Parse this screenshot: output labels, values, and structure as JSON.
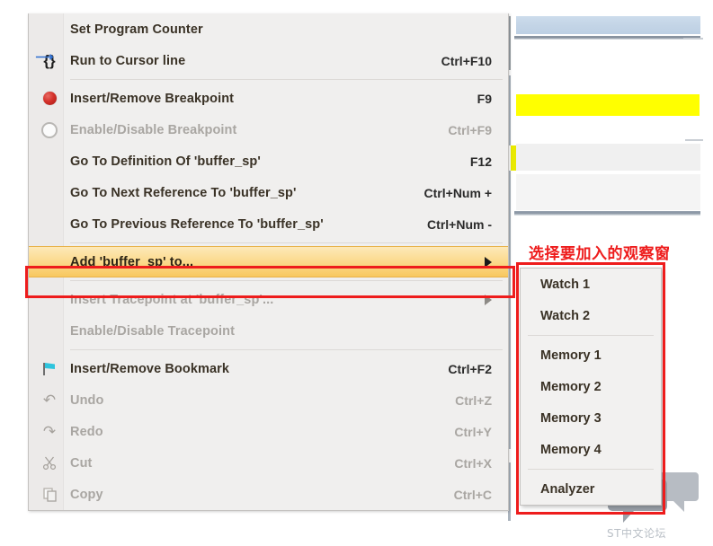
{
  "context_menu": {
    "items": [
      {
        "label": "Set Program Counter",
        "shortcut": "",
        "icon": "",
        "disabled": false,
        "submenu": false
      },
      {
        "label": "Run to Cursor line",
        "shortcut": "Ctrl+F10",
        "icon": "run-to-cursor-icon",
        "disabled": false,
        "submenu": false
      },
      {
        "separator": true
      },
      {
        "label": "Insert/Remove Breakpoint",
        "shortcut": "F9",
        "icon": "breakpoint-icon",
        "disabled": false,
        "submenu": false
      },
      {
        "label": "Enable/Disable Breakpoint",
        "shortcut": "Ctrl+F9",
        "icon": "breakpoint-disabled-icon",
        "disabled": true,
        "submenu": false
      },
      {
        "label": "Go To Definition Of 'buffer_sp'",
        "shortcut": "F12",
        "icon": "",
        "disabled": false,
        "submenu": false
      },
      {
        "label": "Go To Next Reference To 'buffer_sp'",
        "shortcut": "Ctrl+Num +",
        "icon": "",
        "disabled": false,
        "submenu": false
      },
      {
        "label": "Go To Previous Reference To 'buffer_sp'",
        "shortcut": "Ctrl+Num -",
        "icon": "",
        "disabled": false,
        "submenu": false
      },
      {
        "separator": true
      },
      {
        "label": "Add 'buffer_sp' to...",
        "shortcut": "",
        "icon": "",
        "disabled": false,
        "submenu": true,
        "highlighted": true
      },
      {
        "separator": true
      },
      {
        "label": "Insert Tracepoint at 'buffer_sp'...",
        "shortcut": "",
        "icon": "",
        "disabled": true,
        "submenu": true
      },
      {
        "label": "Enable/Disable Tracepoint",
        "shortcut": "",
        "icon": "",
        "disabled": true,
        "submenu": false
      },
      {
        "separator": true
      },
      {
        "label": "Insert/Remove Bookmark",
        "shortcut": "Ctrl+F2",
        "icon": "bookmark-flag-icon",
        "disabled": false,
        "submenu": false
      },
      {
        "label": "Undo",
        "shortcut": "Ctrl+Z",
        "icon": "undo-icon",
        "disabled": true,
        "submenu": false
      },
      {
        "label": "Redo",
        "shortcut": "Ctrl+Y",
        "icon": "redo-icon",
        "disabled": true,
        "submenu": false
      },
      {
        "label": "Cut",
        "shortcut": "Ctrl+X",
        "icon": "cut-scissors-icon",
        "disabled": true,
        "submenu": false
      },
      {
        "label": "Copy",
        "shortcut": "Ctrl+C",
        "icon": "copy-icon",
        "disabled": true,
        "submenu": false
      }
    ]
  },
  "submenu": {
    "items": [
      {
        "label": "Watch 1"
      },
      {
        "label": "Watch 2"
      },
      {
        "separator": true
      },
      {
        "label": "Memory 1"
      },
      {
        "label": "Memory 2"
      },
      {
        "label": "Memory 3"
      },
      {
        "label": "Memory 4"
      },
      {
        "separator": true
      },
      {
        "label": "Analyzer"
      }
    ]
  },
  "annotation": {
    "text": "选择要加入的观察窗",
    "color": "#ee1c1c"
  },
  "watermark": {
    "text": "ST中文论坛"
  },
  "colors": {
    "highlight_border": "#ee1c1c",
    "menu_background": "#f0efee",
    "highlight_row": "#fbd98c",
    "editor_highlight_line": "#ffff00"
  }
}
